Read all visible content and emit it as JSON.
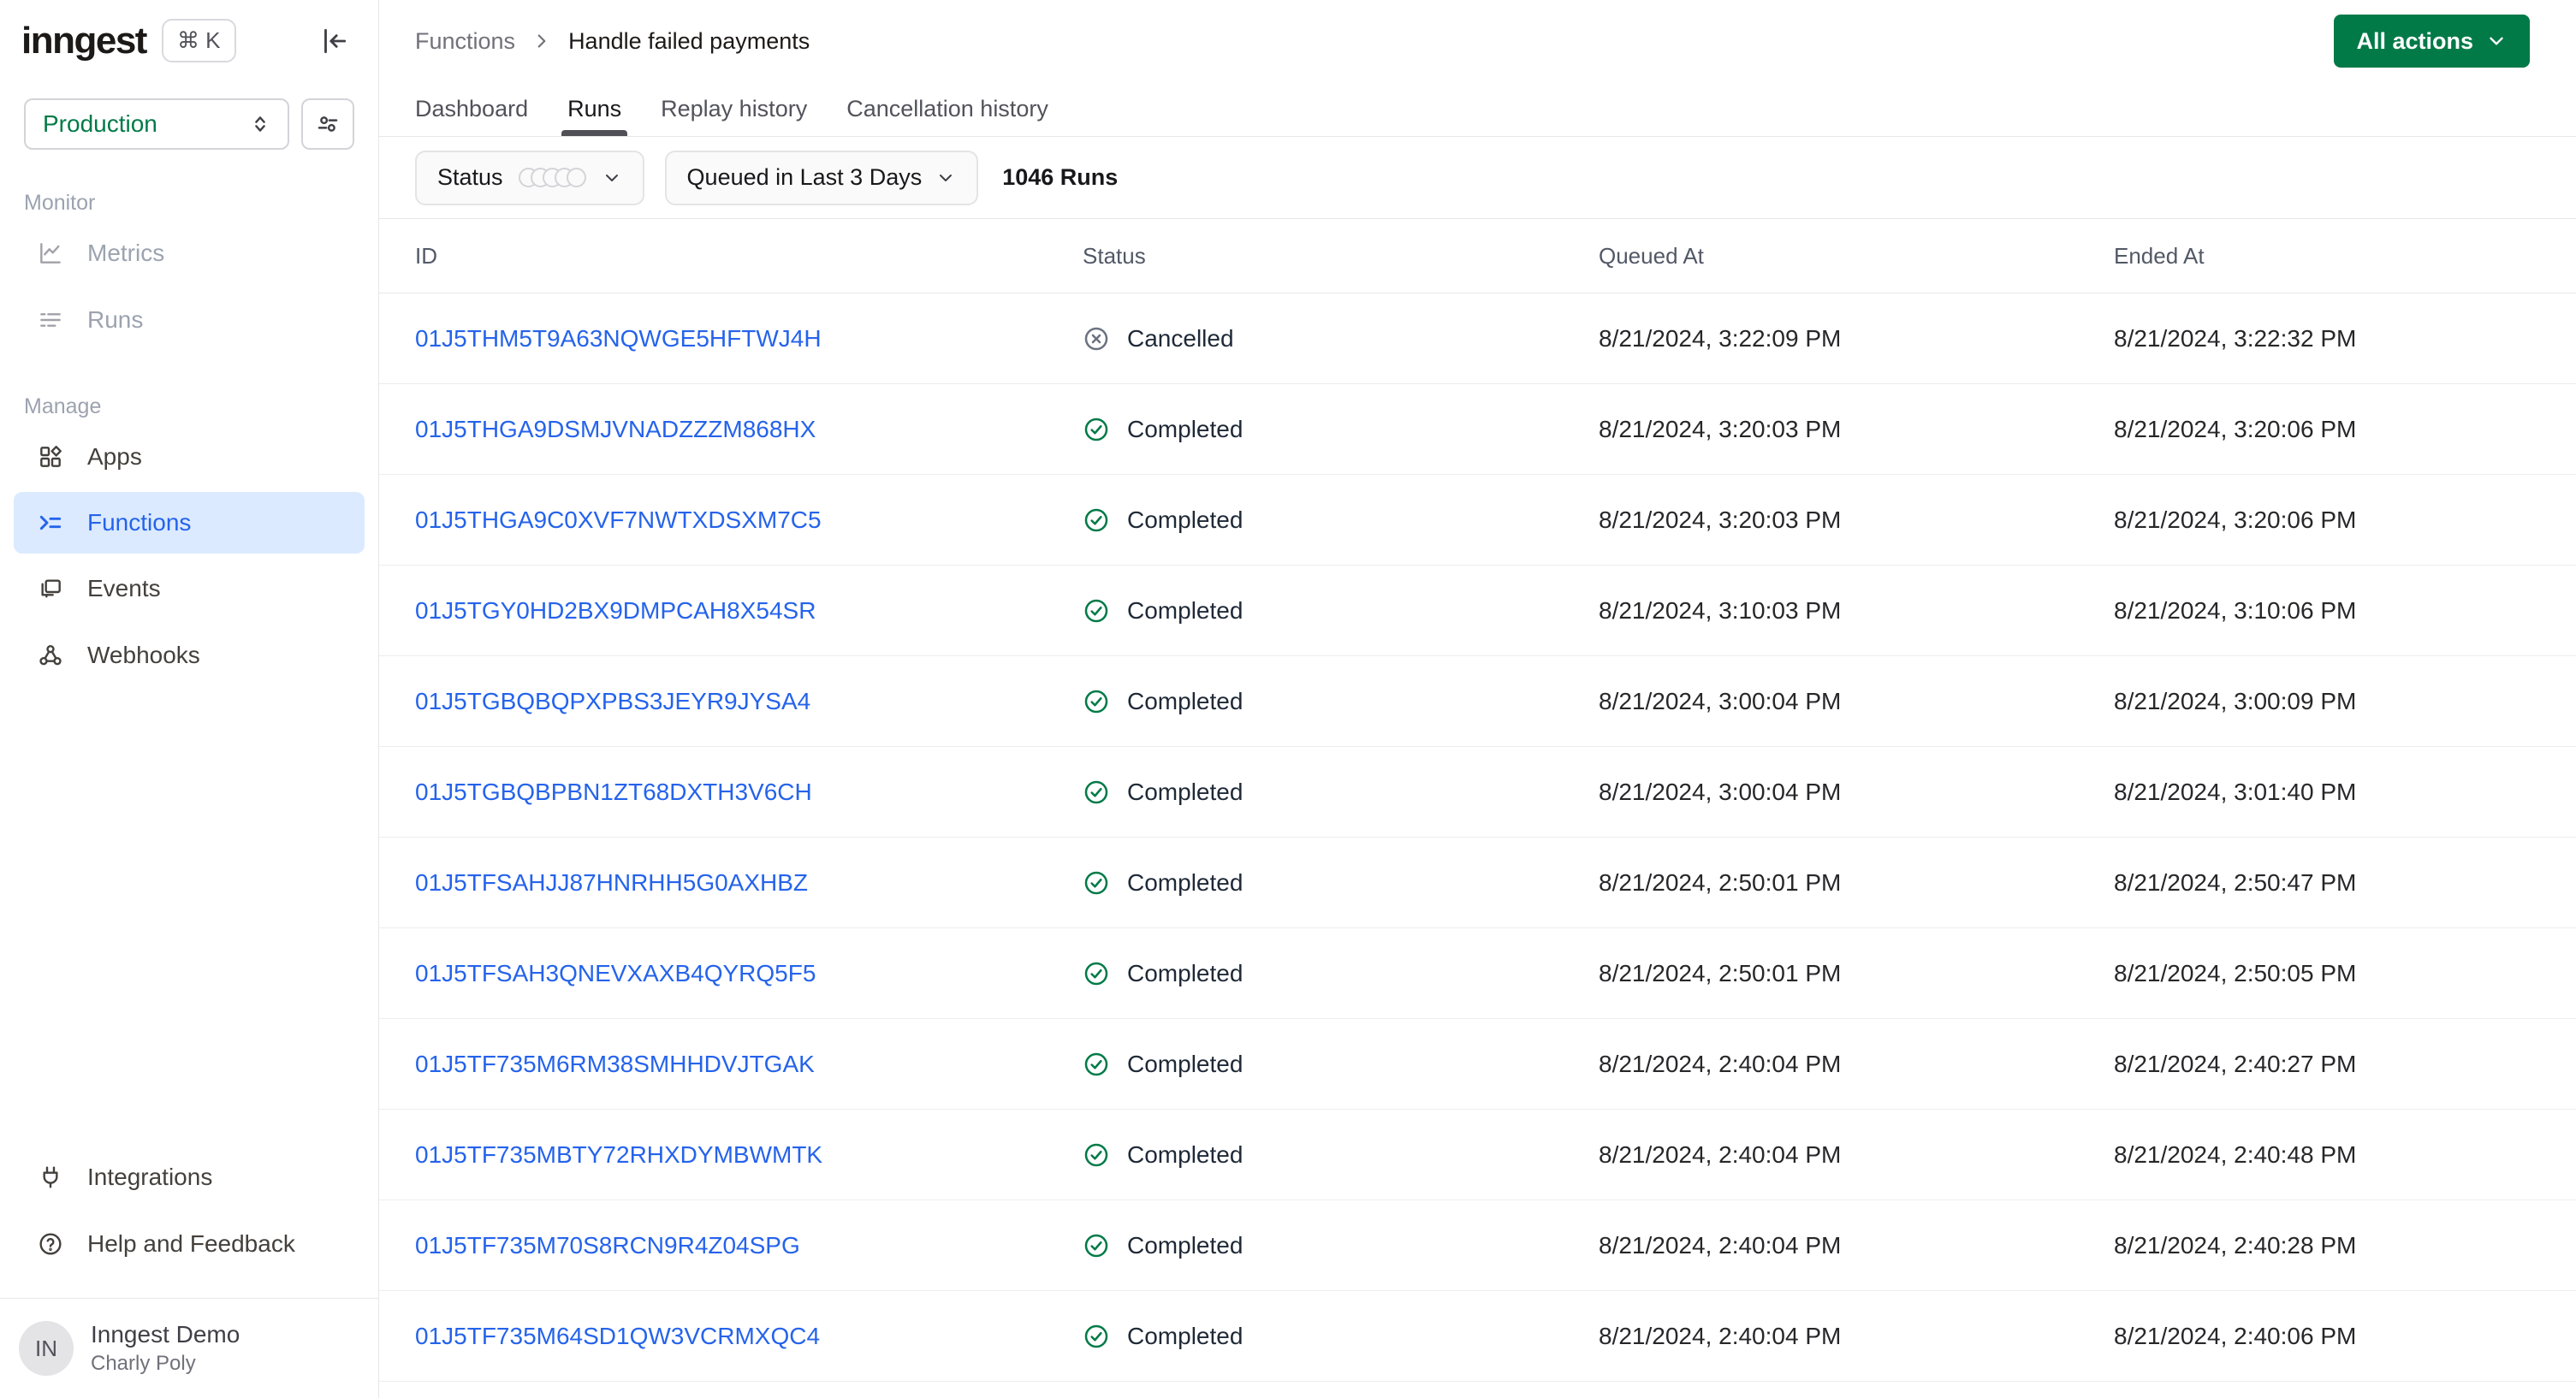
{
  "sidebar": {
    "logo": "inngest",
    "shortcut_keys": "⌘ K",
    "environment": "Production",
    "monitor_label": "Monitor",
    "manage_label": "Manage",
    "metrics": "Metrics",
    "runs": "Runs",
    "apps": "Apps",
    "functions": "Functions",
    "events": "Events",
    "webhooks": "Webhooks",
    "integrations": "Integrations",
    "help": "Help and Feedback",
    "user_initials": "IN",
    "user_org": "Inngest Demo",
    "user_name": "Charly Poly"
  },
  "header": {
    "breadcrumb_parent": "Functions",
    "breadcrumb_current": "Handle failed payments",
    "all_actions": "All actions",
    "tab_dashboard": "Dashboard",
    "tab_runs": "Runs",
    "tab_replay": "Replay history",
    "tab_cancellation": "Cancellation history"
  },
  "filters": {
    "status": "Status",
    "time_range": "Queued in Last 3 Days",
    "count": "1046 Runs"
  },
  "table": {
    "col_id": "ID",
    "col_status": "Status",
    "col_queued": "Queued At",
    "col_ended": "Ended At",
    "rows": [
      {
        "id": "01J5THM5T9A63NQWGE5HFTWJ4H",
        "status": "Cancelled",
        "queued_at": "8/21/2024, 3:22:09 PM",
        "ended_at": "8/21/2024, 3:22:32 PM"
      },
      {
        "id": "01J5THGA9DSMJVNADZZZM868HX",
        "status": "Completed",
        "queued_at": "8/21/2024, 3:20:03 PM",
        "ended_at": "8/21/2024, 3:20:06 PM"
      },
      {
        "id": "01J5THGA9C0XVF7NWTXDSXM7C5",
        "status": "Completed",
        "queued_at": "8/21/2024, 3:20:03 PM",
        "ended_at": "8/21/2024, 3:20:06 PM"
      },
      {
        "id": "01J5TGY0HD2BX9DMPCAH8X54SR",
        "status": "Completed",
        "queued_at": "8/21/2024, 3:10:03 PM",
        "ended_at": "8/21/2024, 3:10:06 PM"
      },
      {
        "id": "01J5TGBQBQPXPBS3JEYR9JYSA4",
        "status": "Completed",
        "queued_at": "8/21/2024, 3:00:04 PM",
        "ended_at": "8/21/2024, 3:00:09 PM"
      },
      {
        "id": "01J5TGBQBPBN1ZT68DXTH3V6CH",
        "status": "Completed",
        "queued_at": "8/21/2024, 3:00:04 PM",
        "ended_at": "8/21/2024, 3:01:40 PM"
      },
      {
        "id": "01J5TFSAHJJ87HNRHH5G0AXHBZ",
        "status": "Completed",
        "queued_at": "8/21/2024, 2:50:01 PM",
        "ended_at": "8/21/2024, 2:50:47 PM"
      },
      {
        "id": "01J5TFSAH3QNEVXAXB4QYRQ5F5",
        "status": "Completed",
        "queued_at": "8/21/2024, 2:50:01 PM",
        "ended_at": "8/21/2024, 2:50:05 PM"
      },
      {
        "id": "01J5TF735M6RM38SMHHDVJTGAK",
        "status": "Completed",
        "queued_at": "8/21/2024, 2:40:04 PM",
        "ended_at": "8/21/2024, 2:40:27 PM"
      },
      {
        "id": "01J5TF735MBTY72RHXDYMBWMTK",
        "status": "Completed",
        "queued_at": "8/21/2024, 2:40:04 PM",
        "ended_at": "8/21/2024, 2:40:48 PM"
      },
      {
        "id": "01J5TF735M70S8RCN9R4Z04SPG",
        "status": "Completed",
        "queued_at": "8/21/2024, 2:40:04 PM",
        "ended_at": "8/21/2024, 2:40:28 PM"
      },
      {
        "id": "01J5TF735M64SD1QW3VCRMXQC4",
        "status": "Completed",
        "queued_at": "8/21/2024, 2:40:04 PM",
        "ended_at": "8/21/2024, 2:40:06 PM"
      }
    ]
  },
  "colors": {
    "accent_green": "#027a48",
    "link_blue": "#2563eb",
    "active_item_bg": "#dbeafe",
    "cancelled_gray": "#6b7280"
  }
}
